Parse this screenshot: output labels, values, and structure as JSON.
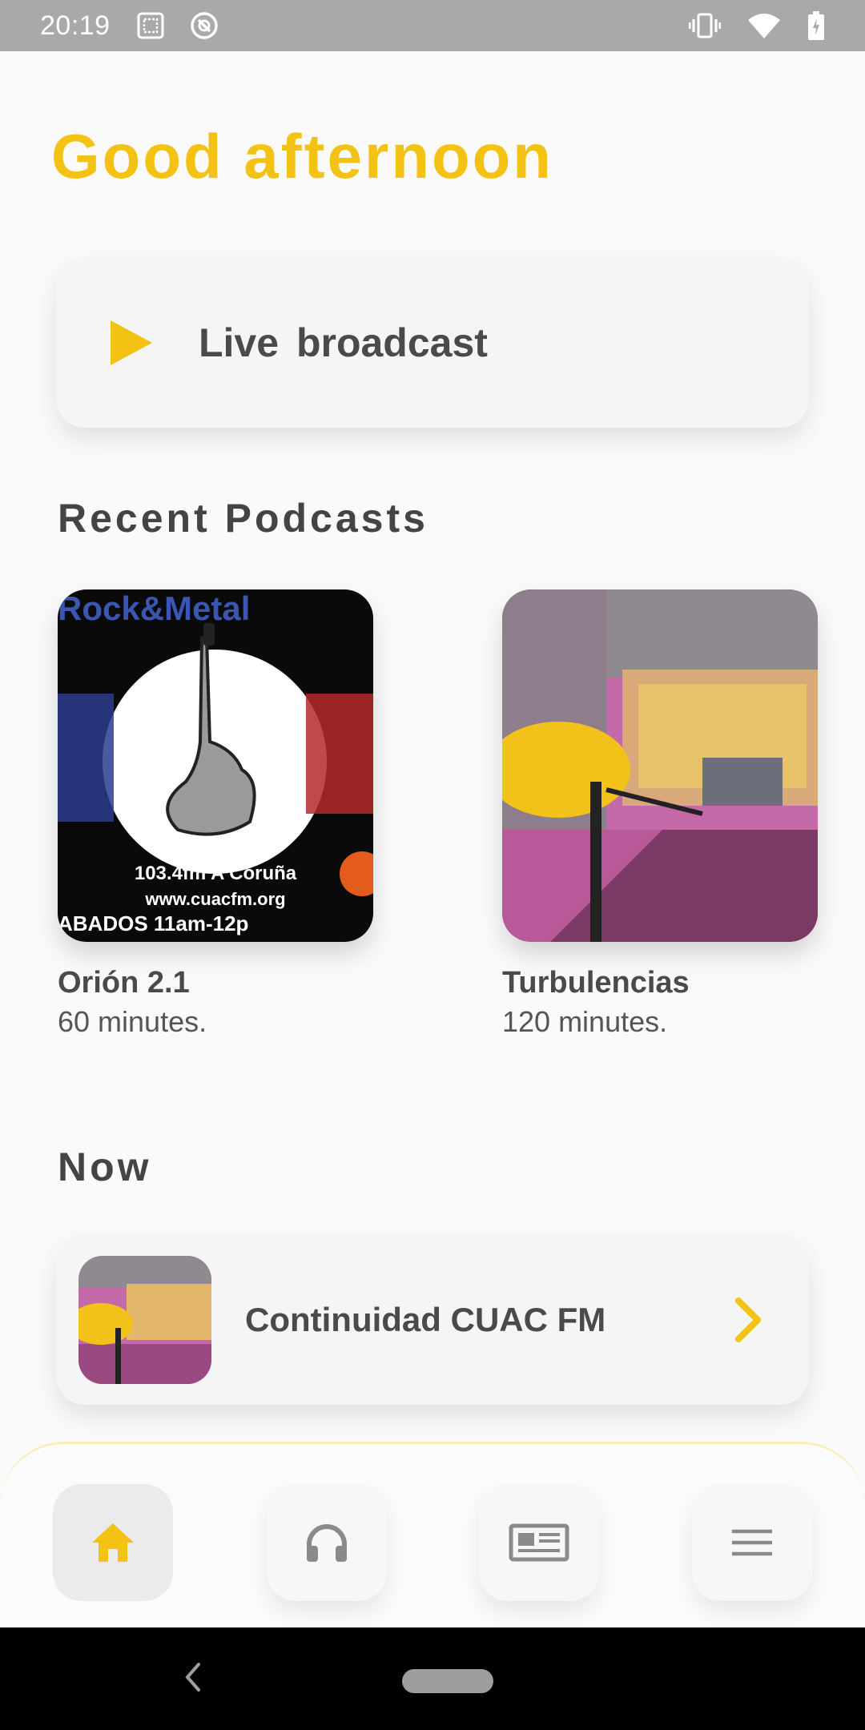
{
  "status_bar": {
    "time": "20:19"
  },
  "greeting": "Good afternoon",
  "live": {
    "label": "Live broadcast"
  },
  "recent": {
    "title": "Recent Podcasts",
    "items": [
      {
        "title": "Orión 2.1",
        "duration": "60 minutes."
      },
      {
        "title": "Turbulencias",
        "duration": "120 minutes."
      }
    ],
    "cover1_text": {
      "banner": "Rock&Metal",
      "freq": "103.4fm A Coruña",
      "site": "www.cuacfm.org",
      "slot": "ABADOS 11am-12p"
    }
  },
  "now": {
    "title": "Now",
    "program": "Continuidad CUAC FM"
  },
  "nav": [
    "home-icon",
    "headphones-icon",
    "news-icon",
    "menu-icon"
  ],
  "colors": {
    "accent": "#f3c213",
    "text": "#4a4a4a",
    "background": "#fafafa"
  }
}
